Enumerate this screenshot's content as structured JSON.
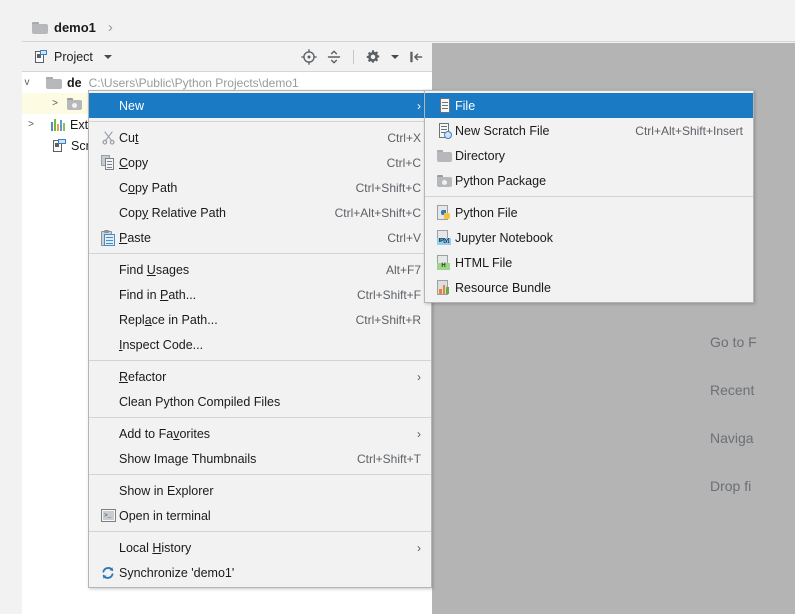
{
  "app": {
    "breadcrumb": {
      "label": "demo1",
      "separator": "›",
      "icon": "folder-icon"
    }
  },
  "tool_window": {
    "title": "Project",
    "icon": "project-icon",
    "dropdown_icon": "chevron-down-icon",
    "actions": [
      {
        "name": "locate-icon",
        "title": "Select Opened File"
      },
      {
        "name": "collapse-all-icon",
        "title": "Collapse All"
      },
      {
        "name": "settings-gear-icon",
        "title": "Settings"
      },
      {
        "name": "hide-icon",
        "title": "Hide"
      }
    ]
  },
  "tree": {
    "rows": [
      {
        "twisty": "v",
        "icon": "folder-icon",
        "label": "de",
        "path": "C:\\Users\\Public\\Python Projects\\demo1",
        "bold": true,
        "selected": false
      },
      {
        "twisty": ">",
        "icon": "pkg-icon",
        "label": "",
        "path": "",
        "bold": false,
        "selected": true
      },
      {
        "twisty": ">",
        "icon": "bars-icon",
        "label": "Ext",
        "path": "",
        "bold": false,
        "selected": false
      },
      {
        "twisty": "",
        "icon": "scratch-icon",
        "label": "Scr",
        "path": "",
        "bold": false,
        "selected": false
      }
    ]
  },
  "editor": {
    "hints": [
      "Go to F",
      "Recent",
      "Naviga",
      "Drop fi"
    ]
  },
  "context_menu": {
    "items": [
      {
        "label": "New",
        "accel": "",
        "icon": "",
        "arrow": true,
        "highlighted": true,
        "mnemonic": ""
      },
      {
        "separator": false,
        "label": "Cut",
        "accel": "Ctrl+X",
        "icon": "cut-icon",
        "arrow": false,
        "highlighted": false,
        "mnemonic": "t"
      },
      {
        "label": "Copy",
        "accel": "Ctrl+C",
        "icon": "copy-icon",
        "arrow": false,
        "highlighted": false,
        "mnemonic": "C"
      },
      {
        "label": "Copy Path",
        "accel": "Ctrl+Shift+C",
        "icon": "",
        "arrow": false,
        "highlighted": false,
        "mnemonic": "o"
      },
      {
        "label": "Copy Relative Path",
        "accel": "Ctrl+Alt+Shift+C",
        "icon": "",
        "arrow": false,
        "highlighted": false,
        "mnemonic": "y"
      },
      {
        "label": "Paste",
        "accel": "Ctrl+V",
        "icon": "paste-icon",
        "arrow": false,
        "highlighted": false,
        "mnemonic": "P"
      },
      {
        "label": "Find Usages",
        "accel": "Alt+F7",
        "icon": "",
        "arrow": false,
        "highlighted": false,
        "mnemonic": "U"
      },
      {
        "label": "Find in Path...",
        "accel": "Ctrl+Shift+F",
        "icon": "",
        "arrow": false,
        "highlighted": false,
        "mnemonic": "P"
      },
      {
        "label": "Replace in Path...",
        "accel": "Ctrl+Shift+R",
        "icon": "",
        "arrow": false,
        "highlighted": false,
        "mnemonic": "a"
      },
      {
        "label": "Inspect Code...",
        "accel": "",
        "icon": "",
        "arrow": false,
        "highlighted": false,
        "mnemonic": "I"
      },
      {
        "label": "Refactor",
        "accel": "",
        "icon": "",
        "arrow": true,
        "highlighted": false,
        "mnemonic": "R"
      },
      {
        "label": "Clean Python Compiled Files",
        "accel": "",
        "icon": "",
        "arrow": false,
        "highlighted": false,
        "mnemonic": ""
      },
      {
        "label": "Add to Favorites",
        "accel": "",
        "icon": "",
        "arrow": true,
        "highlighted": false,
        "mnemonic": "v"
      },
      {
        "label": "Show Image Thumbnails",
        "accel": "Ctrl+Shift+T",
        "icon": "",
        "arrow": false,
        "highlighted": false,
        "mnemonic": ""
      },
      {
        "label": "Show in Explorer",
        "accel": "",
        "icon": "",
        "arrow": false,
        "highlighted": false,
        "mnemonic": ""
      },
      {
        "label": "Open in terminal",
        "accel": "",
        "icon": "terminal-icon",
        "arrow": false,
        "highlighted": false,
        "mnemonic": ""
      },
      {
        "label": "Local History",
        "accel": "",
        "icon": "",
        "arrow": true,
        "highlighted": false,
        "mnemonic": "H"
      },
      {
        "label": "Synchronize 'demo1'",
        "accel": "",
        "icon": "sync-icon",
        "arrow": false,
        "highlighted": false,
        "mnemonic": ""
      }
    ]
  },
  "submenu": {
    "items": [
      {
        "label": "File",
        "accel": "",
        "icon": "file-icon",
        "highlighted": true
      },
      {
        "label": "New Scratch File",
        "accel": "Ctrl+Alt+Shift+Insert",
        "icon": "scratch-file-icon",
        "highlighted": false
      },
      {
        "label": "Directory",
        "accel": "",
        "icon": "directory-icon",
        "highlighted": false
      },
      {
        "label": "Python Package",
        "accel": "",
        "icon": "python-package-icon",
        "highlighted": false
      },
      {
        "label": "Python File",
        "accel": "",
        "icon": "python-file-icon",
        "highlighted": false
      },
      {
        "label": "Jupyter Notebook",
        "accel": "",
        "icon": "jupyter-notebook-icon",
        "highlighted": false
      },
      {
        "label": "HTML File",
        "accel": "",
        "icon": "html-file-icon",
        "highlighted": false
      },
      {
        "label": "Resource Bundle",
        "accel": "",
        "icon": "resource-bundle-icon",
        "highlighted": false
      }
    ]
  },
  "colors": {
    "highlight": "#1a7ac4",
    "menu_bg": "#f2f2f2",
    "menu_border": "#b5b5b5",
    "editor_bg": "#b4b4b4",
    "accel_text": "#5d6166",
    "selection_row": "#fdfbe2"
  }
}
